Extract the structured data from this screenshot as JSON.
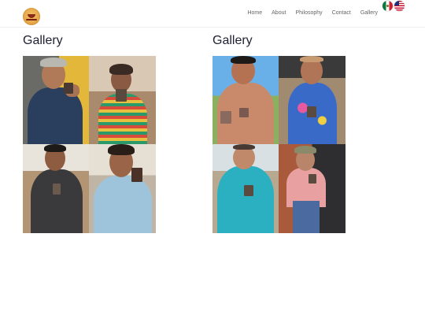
{
  "header": {
    "logo_icon": "restaurant-logo-icon",
    "nav": [
      {
        "label": "Home"
      },
      {
        "label": "About"
      },
      {
        "label": "Philosophy"
      },
      {
        "label": "Contact"
      },
      {
        "label": "Gallery"
      }
    ],
    "flags": [
      {
        "icon": "mexico-flag-icon",
        "language": "es"
      },
      {
        "icon": "usa-flag-icon",
        "language": "en"
      }
    ]
  },
  "galleries": [
    {
      "title": "Gallery",
      "photos": [
        {
          "description": "man in navy t-shirt holding product"
        },
        {
          "description": "woman in striped top holding product"
        },
        {
          "description": "young man in dark t-shirt holding product"
        },
        {
          "description": "woman in light blue top holding product"
        }
      ]
    },
    {
      "title": "Gallery",
      "photos": [
        {
          "description": "shirtless man holding product outdoors"
        },
        {
          "description": "woman in floral top holding product"
        },
        {
          "description": "man in turquoise polo holding product"
        },
        {
          "description": "man in pink shirt and cap holding product"
        }
      ]
    }
  ],
  "colors": {
    "nav_text": "#666666",
    "title_text": "#222235",
    "header_border": "#eeeeee"
  }
}
